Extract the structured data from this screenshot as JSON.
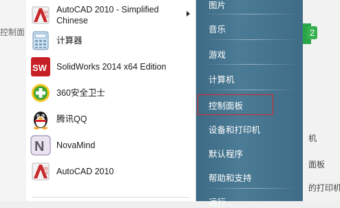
{
  "background": {
    "left_text": "控制面",
    "right_green_text": "2",
    "right_items": [
      "机",
      "面板",
      "的打印机"
    ]
  },
  "programs": [
    {
      "label_line1": "AutoCAD 2010 - Simplified",
      "label_line2": "Chinese",
      "icon": "autocad-icon",
      "has_submenu": true
    },
    {
      "label": "计算器",
      "icon": "calculator-icon"
    },
    {
      "label": "SolidWorks 2014 x64 Edition",
      "icon": "solidworks-icon"
    },
    {
      "label": "360安全卫士",
      "icon": "360-security-icon"
    },
    {
      "label": "腾讯QQ",
      "icon": "qq-penguin-icon"
    },
    {
      "label": "NovaMind",
      "icon": "novamind-icon"
    },
    {
      "label": "AutoCAD 2010",
      "icon": "autocad-icon"
    }
  ],
  "places": [
    {
      "label": "图片"
    },
    {
      "label": "音乐"
    },
    {
      "label": "游戏"
    },
    {
      "label": "计算机"
    },
    {
      "label": "控制面板",
      "highlighted": true
    },
    {
      "label": "设备和打印机"
    },
    {
      "label": "默认程序"
    },
    {
      "label": "帮助和支持"
    },
    {
      "label": "运行..."
    }
  ],
  "colors": {
    "places_bg": "#44738d",
    "highlight": "#e0242c"
  }
}
